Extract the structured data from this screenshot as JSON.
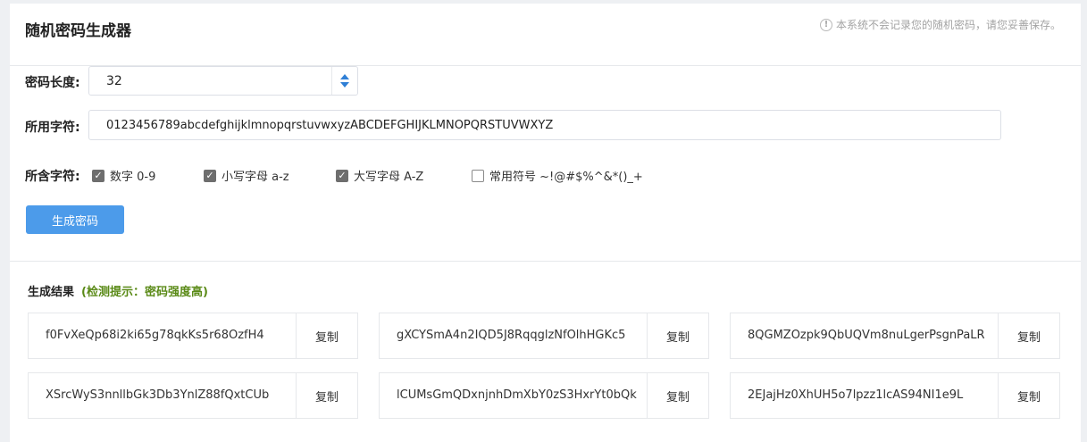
{
  "header": {
    "title": "随机密码生成器",
    "notice_icon": "info-circle-icon",
    "notice": "本系统不会记录您的随机密码，请您妥善保存。"
  },
  "length": {
    "label": "密码长度:",
    "value": "32"
  },
  "chars": {
    "label": "所用字符:",
    "value": "0123456789abcdefghijklmnopqrstuvwxyzABCDEFGHIJKLMNOPQRSTUVWXYZ"
  },
  "include": {
    "label": "所含字符:",
    "options": [
      {
        "label": "数字 0-9",
        "checked": true
      },
      {
        "label": "小写字母 a-z",
        "checked": true
      },
      {
        "label": "大写字母 A-Z",
        "checked": true
      },
      {
        "label": "常用符号 ~!@#$%^&*()_+",
        "checked": false
      }
    ]
  },
  "generate_label": "生成密码",
  "results": {
    "title": "生成结果",
    "hint": "(检测提示：密码强度高)",
    "copy_label": "复制",
    "passwords": [
      "f0FvXeQp68i2ki65g78qkKs5r68OzfH4",
      "gXCYSmA4n2IQD5J8RqqglzNfOlhHGKc5",
      "8QGMZOzpk9QbUQVm8nuLgerPsgnPaLR",
      "XSrcWyS3nnllbGk3Db3YnlZ88fQxtCUb",
      "lCUMsGmQDxnjnhDmXbY0zS3HxrYt0bQk",
      "2EJajHz0XhUH5o7lpzz1lcAS94NI1e9L"
    ]
  }
}
